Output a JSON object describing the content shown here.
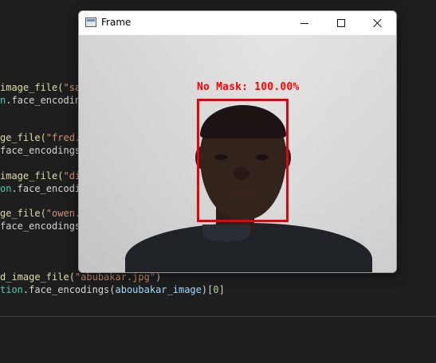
{
  "editor": {
    "lines": [
      {
        "t1": "image_file(",
        "t2": "\"samue"
      },
      {
        "t1": "n",
        "t2": ".face_encodings"
      },
      {
        "t1": "ge_file(",
        "t2": "\"fred.jp"
      },
      {
        "t1": "face_encodings",
        "t2": "("
      },
      {
        "t1": "image_file(",
        "t2": "\"dick"
      },
      {
        "t1": "on",
        "t2": ".face_encoding"
      },
      {
        "t1": "ge_file(",
        "t2": "\"owen.jp"
      },
      {
        "t1": "face_encodings",
        "t2": "("
      },
      {
        "t1": "d_image_file(",
        "t2": "\"abubakar.jpg\"",
        "t3": ")"
      },
      {
        "t1": "tion",
        "t2": ".face_encodings(",
        "t3": "aboubakar_image",
        "t4": ")[",
        "t5": "0",
        "t6": "]"
      }
    ]
  },
  "window": {
    "title": "Frame",
    "controls": {
      "minimize": "minimize",
      "maximize": "maximize",
      "close": "close"
    }
  },
  "detection": {
    "label": "No Mask: 100.00%",
    "color": "#ff0000"
  }
}
